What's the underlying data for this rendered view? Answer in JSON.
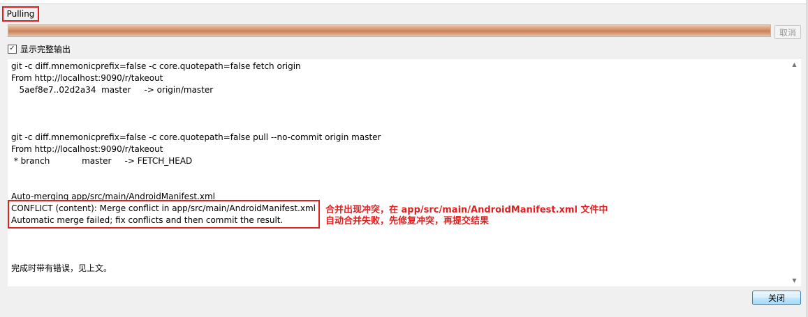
{
  "window": {
    "title": "Pulling",
    "cancel_label": "取消",
    "close_label": "关闭",
    "progress_fraction": 1.0
  },
  "options": {
    "show_full_output_label": "显示完整输出",
    "show_full_output_checked": true
  },
  "log": {
    "lines": [
      "git -c diff.mnemonicprefix=false -c core.quotepath=false fetch origin",
      "From http://localhost:9090/r/takeout",
      "   5aef8e7..02d2a34  master     -> origin/master",
      "",
      "",
      "",
      "git -c diff.mnemonicprefix=false -c core.quotepath=false pull --no-commit origin master",
      "From http://localhost:9090/r/takeout",
      " * branch            master     -> FETCH_HEAD",
      "",
      "",
      "Auto-merging app/src/main/AndroidManifest.xml",
      "CONFLICT (content): Merge conflict in app/src/main/AndroidManifest.xml",
      "Automatic merge failed; fix conflicts and then commit the result.",
      "",
      "",
      "",
      "完成时带有错误，见上文。"
    ]
  },
  "annotation": {
    "line1": "合并出现冲突，在 app/src/main/AndroidManifest.xml 文件中",
    "line2": "自动合并失败，先修复冲突，再提交结果"
  },
  "colors": {
    "annotation_red": "#e02020",
    "progress_fill": "#d89a76"
  }
}
